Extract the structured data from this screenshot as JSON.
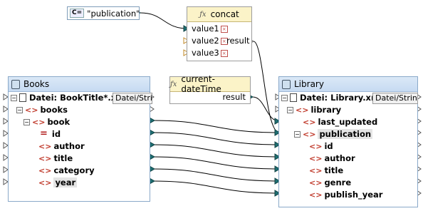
{
  "constant": {
    "type_icon": "C=",
    "value": "\"publication\""
  },
  "concat": {
    "title": "concat",
    "inputs": [
      "value1",
      "value2",
      "value3"
    ],
    "output": "result"
  },
  "datetime": {
    "title": "current-dateTime",
    "output": "result"
  },
  "books": {
    "title": "Books",
    "file_label": "Datei: BookTitle*.xml",
    "type_button": "Datei/Strin",
    "nodes": {
      "books": "books",
      "book": "book",
      "id": "id",
      "author": "author",
      "title": "title",
      "category": "category",
      "year": "year"
    }
  },
  "library": {
    "title": "Library",
    "file_label": "Datei: Library.xml",
    "type_button": "Datei/Strinc",
    "nodes": {
      "library": "library",
      "last_updated": "last_updated",
      "publication": "publication",
      "id": "id",
      "author": "author",
      "title": "title",
      "genre": "genre",
      "publish_year": "publish_year"
    }
  },
  "colors": {
    "connector": "#1f6f72",
    "wire": "#000000",
    "attr": "#b01818",
    "header_blue": "#c7dbf2",
    "func_header": "#fbf3c8"
  }
}
